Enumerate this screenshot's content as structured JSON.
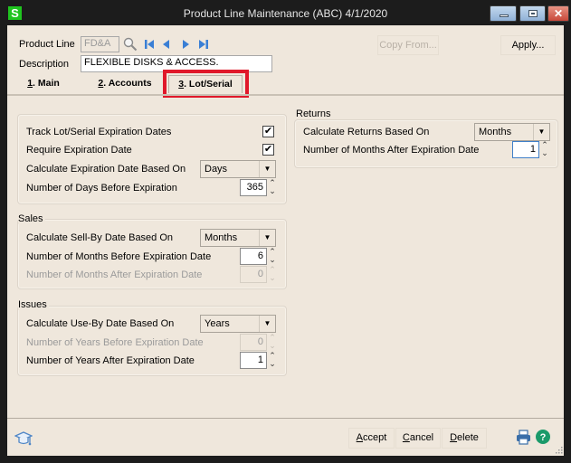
{
  "window": {
    "app_icon": "S",
    "title": "Product Line Maintenance (ABC) 4/1/2020",
    "controls": {
      "minimize": "minimize-icon",
      "maximize": "maximize-icon",
      "close": "close-icon",
      "close_glyph": "✕"
    }
  },
  "header": {
    "product_line_label": "Product Line",
    "product_line_value": "FD&A",
    "description_label": "Description",
    "description_value": "FLEXIBLE DISKS & ACCESS.",
    "lookup_icon": "magnifier-icon",
    "nav_icons": [
      "first-record-icon",
      "previous-record-icon",
      "next-record-icon",
      "last-record-icon"
    ],
    "copy_from_label": "Copy From...",
    "apply_label": "Apply..."
  },
  "tabs": [
    {
      "hotkey": "1",
      "label": ". Main",
      "active": false
    },
    {
      "hotkey": "2",
      "label": ". Accounts",
      "active": false
    },
    {
      "hotkey": "3",
      "label": ". Lot/Serial",
      "active": true
    }
  ],
  "highlight_color": "#e0182a",
  "expiration": {
    "track_label": "Track Lot/Serial Expiration Dates",
    "track_checked": true,
    "require_label": "Require Expiration Date",
    "require_checked": true,
    "calc_label": "Calculate Expiration Date Based On",
    "calc_value": "Days",
    "days_label": "Number of Days Before Expiration",
    "days_value": "365"
  },
  "sales": {
    "title": "Sales",
    "calc_label": "Calculate Sell-By Date Based On",
    "calc_value": "Months",
    "before_label": "Number of Months Before Expiration Date",
    "before_value": "6",
    "after_label": "Number of Months After Expiration Date",
    "after_value": "0"
  },
  "issues": {
    "title": "Issues",
    "calc_label": "Calculate Use-By Date Based On",
    "calc_value": "Years",
    "before_label": "Number of Years Before Expiration Date",
    "before_value": "0",
    "after_label": "Number of Years After Expiration Date",
    "after_value": "1"
  },
  "returns": {
    "title": "Returns",
    "calc_label": "Calculate Returns Based On",
    "calc_value": "Months",
    "after_label": "Number of Months After Expiration Date",
    "after_value": "1"
  },
  "footer": {
    "accept_hotkey": "A",
    "accept_rest": "ccept",
    "cancel_hotkey": "C",
    "cancel_rest": "ancel",
    "delete_hotkey": "D",
    "delete_rest": "elete",
    "help_glyph": "?",
    "checkmark": "✔",
    "spin_up": "⌃",
    "spin_down": "⌄",
    "dropdown_arrow": "▼"
  }
}
